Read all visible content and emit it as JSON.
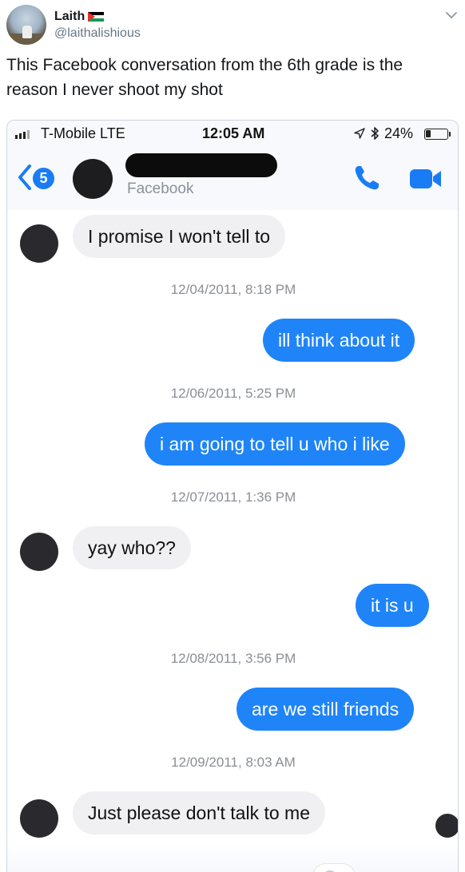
{
  "tweet": {
    "display_name": "Laith",
    "handle": "@laithalishious",
    "flag_icon": "palestine-flag-icon",
    "menu_icon": "chevron-down-icon",
    "text": "This Facebook conversation from the 6th grade is the reason I never shoot my shot"
  },
  "phone": {
    "status_bar": {
      "carrier": "T-Mobile  LTE",
      "time": "12:05 AM",
      "battery": "24%",
      "battery_level": 0.24
    },
    "nav": {
      "back_count": "5",
      "contact_subtitle": "Facebook",
      "accent": "#1a7cf5"
    },
    "messages": [
      {
        "kind": "in",
        "text": "I promise I won't tell to"
      },
      {
        "kind": "stamp",
        "text": "12/04/2011, 8:18 PM"
      },
      {
        "kind": "out",
        "text": "ill think about it"
      },
      {
        "kind": "stamp",
        "text": "12/06/2011, 5:25 PM"
      },
      {
        "kind": "out",
        "text": "i am going to tell u who i like"
      },
      {
        "kind": "stamp",
        "text": "12/07/2011, 1:36 PM"
      },
      {
        "kind": "in",
        "text": "yay who??"
      },
      {
        "kind": "out",
        "text": "it is u"
      },
      {
        "kind": "stamp",
        "text": "12/08/2011, 3:56 PM"
      },
      {
        "kind": "out",
        "text": "are we still friends"
      },
      {
        "kind": "stamp",
        "text": "12/09/2011, 8:03 AM"
      },
      {
        "kind": "in",
        "text": "Just please don't talk to me"
      }
    ],
    "colors": {
      "outgoing_bubble": "#1f84f8",
      "incoming_bubble": "#f0f0f2"
    }
  }
}
